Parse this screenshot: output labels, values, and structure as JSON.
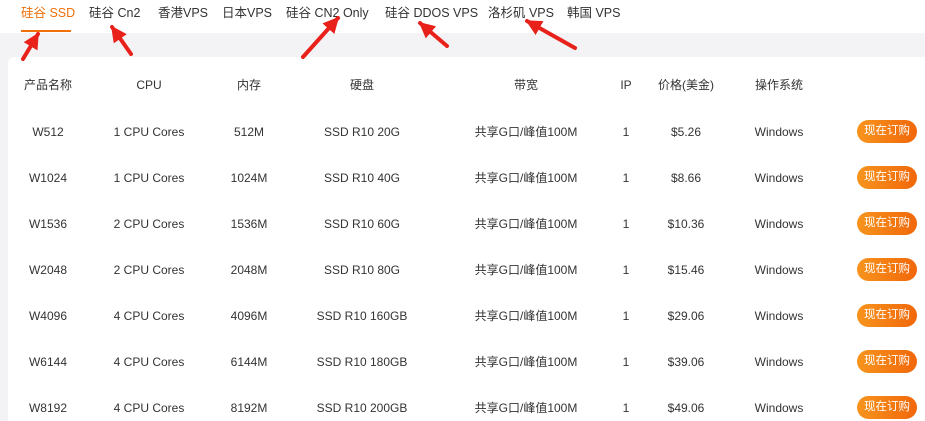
{
  "tabs": [
    {
      "label": "硅谷 SSD",
      "active": true
    },
    {
      "label": "硅谷 Cn2",
      "active": false
    },
    {
      "label": "香港VPS",
      "active": false
    },
    {
      "label": "日本VPS",
      "active": false
    },
    {
      "label": "硅谷 CN2 Only",
      "active": false
    },
    {
      "label": "硅谷 DDOS VPS",
      "active": false
    },
    {
      "label": "洛杉矶 VPS",
      "active": false
    },
    {
      "label": "韩国 VPS",
      "active": false
    }
  ],
  "table": {
    "headers": [
      "产品名称",
      "CPU",
      "内存",
      "硬盘",
      "带宽",
      "IP",
      "价格(美金)",
      "操作系统"
    ],
    "rows": [
      [
        "W512",
        "1 CPU Cores",
        "512M",
        "SSD R10 20G",
        "共享G口/峰值100M",
        "1",
        "$5.26",
        "Windows"
      ],
      [
        "W1024",
        "1 CPU Cores",
        "1024M",
        "SSD R10 40G",
        "共享G口/峰值100M",
        "1",
        "$8.66",
        "Windows"
      ],
      [
        "W1536",
        "2 CPU Cores",
        "1536M",
        "SSD R10 60G",
        "共享G口/峰值100M",
        "1",
        "$10.36",
        "Windows"
      ],
      [
        "W2048",
        "2 CPU Cores",
        "2048M",
        "SSD R10 80G",
        "共享G口/峰值100M",
        "1",
        "$15.46",
        "Windows"
      ],
      [
        "W4096",
        "4 CPU Cores",
        "4096M",
        "SSD R10 160GB",
        "共享G口/峰值100M",
        "1",
        "$29.06",
        "Windows"
      ],
      [
        "W6144",
        "4 CPU Cores",
        "6144M",
        "SSD R10 180GB",
        "共享G口/峰值100M",
        "1",
        "$39.06",
        "Windows"
      ],
      [
        "W8192",
        "4 CPU Cores",
        "8192M",
        "SSD R10 200GB",
        "共享G口/峰值100M",
        "1",
        "$49.06",
        "Windows"
      ]
    ],
    "order_button_label": "现在订购"
  },
  "colors": {
    "accent": "#f0700a",
    "arrow": "#e8211a",
    "button_gradient_start": "#f7941d",
    "button_gradient_end": "#f1670a",
    "background_band": "#f3f3f5"
  },
  "annotations": {
    "arrow_icon": "red-arrow-icon",
    "arrow_count": 5
  }
}
